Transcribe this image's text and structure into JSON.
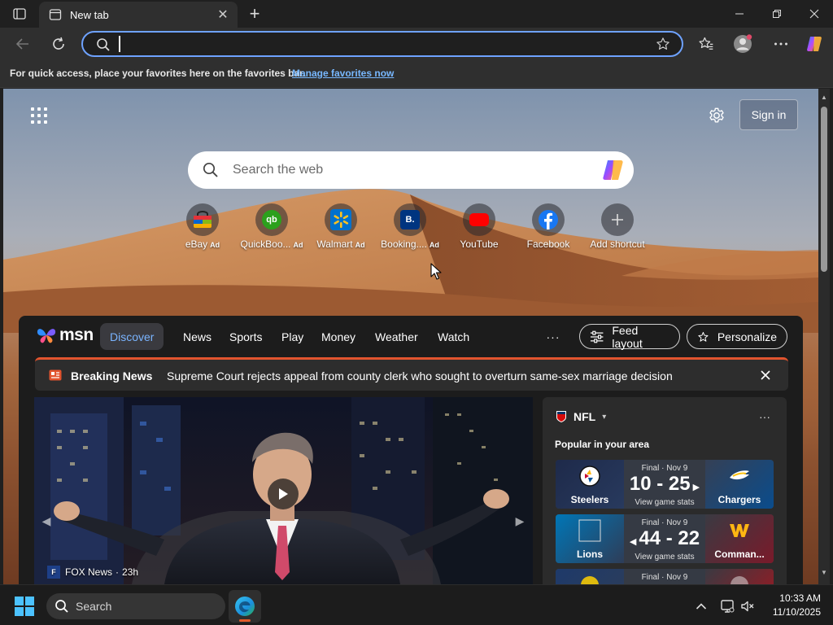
{
  "browser": {
    "tab": {
      "title": "New tab",
      "close_glyph": "✕",
      "icon": "newtab-icon"
    },
    "new_tab_glyph": "+",
    "window_controls": {
      "minimize": "minimize-icon",
      "maximize": "maximize-icon",
      "close": "close-icon"
    },
    "address_bar": {
      "value": "",
      "placeholder": ""
    },
    "favorites_bar": {
      "text": "For quick access, place your favorites here on the favorites bar.",
      "link": "Manage favorites now"
    }
  },
  "newtab": {
    "signin_label": "Sign in",
    "search_placeholder": "Search the web",
    "shortcuts": [
      {
        "label": "eBay",
        "ad": "Ad",
        "icon": "ebay-icon"
      },
      {
        "label": "QuickBoo...",
        "ad": "Ad",
        "icon": "quickbooks-icon"
      },
      {
        "label": "Walmart",
        "ad": "Ad",
        "icon": "walmart-icon"
      },
      {
        "label": "Booking....",
        "ad": "Ad",
        "icon": "booking-icon"
      },
      {
        "label": "YouTube",
        "ad": "",
        "icon": "youtube-icon"
      },
      {
        "label": "Facebook",
        "ad": "",
        "icon": "facebook-icon"
      },
      {
        "label": "Add shortcut",
        "ad": "",
        "icon": "plus-icon"
      }
    ]
  },
  "msn": {
    "logo": "msn",
    "tabs": [
      "Discover",
      "News",
      "Sports",
      "Play",
      "Money",
      "Weather",
      "Watch"
    ],
    "more_glyph": "···",
    "feed_layout_label": "Feed layout",
    "personalize_label": "Personalize",
    "breaking": {
      "label": "Breaking News",
      "headline": "Supreme Court rejects appeal from county clerk who sought to overturn same-sex marriage decision"
    },
    "hero": {
      "source": "FOX News",
      "age": "23h",
      "source_logo": "F"
    },
    "nfl": {
      "title": "NFL",
      "subtitle": "Popular in your area",
      "more_glyph": "···",
      "games": [
        {
          "status": "Final · Nov 9",
          "score": "10 - 25",
          "stats": "View game stats",
          "home": "Steelers",
          "away": "Chargers",
          "winner": "right",
          "home_color": "#1e2a4a",
          "away_color": "#0a4c8c"
        },
        {
          "status": "Final · Nov 9",
          "score": "44 - 22",
          "stats": "View game stats",
          "home": "Lions",
          "away": "Comman...",
          "winner": "left",
          "home_color": "#0076b6",
          "away_color": "#5a1414"
        },
        {
          "status": "Final · Nov 9",
          "score": "",
          "stats": "",
          "home": "",
          "away": "",
          "winner": "",
          "home_color": "#1e3a6a",
          "away_color": "#a5151e"
        }
      ]
    }
  },
  "taskbar": {
    "search_label": "Search",
    "time": "10:33 AM",
    "date": "11/10/2025"
  },
  "colors": {
    "accent": "#6ea2ff",
    "breaking_red": "#e2542e",
    "discover_blue": "#7ab4ff",
    "windows_blue": "#4cc2ff"
  }
}
